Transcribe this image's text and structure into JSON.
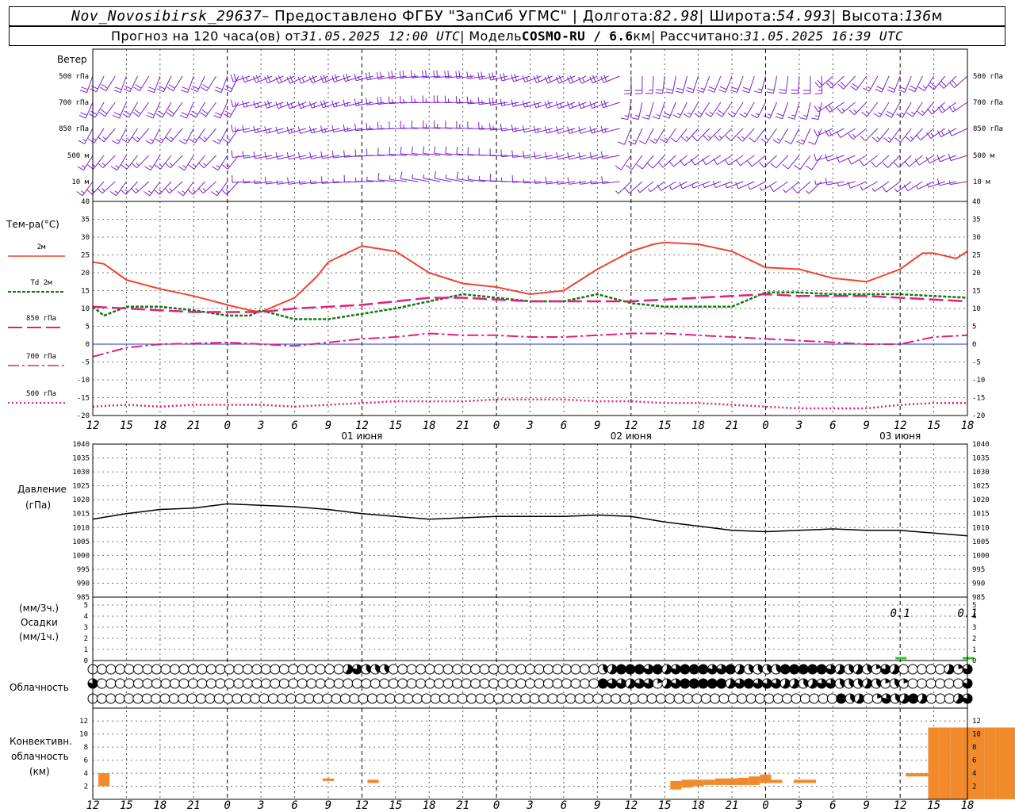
{
  "header": {
    "station": "Nov_Novosibirsk_29637",
    "sep1": " – Предоставлено ФГБУ \"ЗапСиб УГМС\" | Долгота: ",
    "lon": "82.98",
    "sep2": " | Широта: ",
    "lat": "54.993",
    "sep3": " | Высота: ",
    "alt": "136",
    "alt_unit": "м"
  },
  "subheader": {
    "prefix": "Прогноз на 120 часа(ов) от ",
    "issued": "31.05.2025 12:00 UTC",
    "model_prefix": "  | Модель ",
    "model": "COSMO-RU / 6.6",
    "model_unit": "км",
    "calc_prefix": " | Рассчитано: ",
    "calculated": "31.05.2025 16:39 UTC"
  },
  "colors": {
    "t2m": "#ee4433",
    "td2m": "#117711",
    "t850": "#e0207a",
    "t700": "#e0207a",
    "t500": "#e0207a",
    "wind": "#7a22cc",
    "precip": "#22cc22",
    "convective": "#f08a2a",
    "pressure": "#000000",
    "zero_line": "#2233cc"
  },
  "x_axis": {
    "hour_labels": [
      "12",
      "15",
      "18",
      "21",
      "0",
      "3",
      "6",
      "9",
      "12",
      "15",
      "18",
      "21",
      "0",
      "3",
      "6",
      "9",
      "12",
      "15",
      "18",
      "21",
      "0",
      "3",
      "6",
      "9",
      "12",
      "15",
      "18"
    ],
    "date_labels": [
      {
        "label": "01 июня",
        "hour_index": 24
      },
      {
        "label": "02 июня",
        "hour_index": 48
      },
      {
        "label": "03 июня",
        "hour_index": 72
      }
    ]
  },
  "wind_panel": {
    "title": "Ветер",
    "levels": [
      "500 гПа",
      "700 гПа",
      "850 гПа",
      "500 м",
      "10  м"
    ]
  },
  "temp_panel": {
    "title": "Тем-ра(°C)",
    "legend": [
      "2м",
      "Td  2м",
      "850 гПа",
      "700 гПа",
      "500 гПа"
    ],
    "y_ticks": [
      "40",
      "35",
      "30",
      "25",
      "20",
      "15",
      "10",
      "5",
      "0",
      "-5",
      "-10",
      "-15",
      "-20"
    ]
  },
  "pressure_panel": {
    "title": "Давление",
    "unit": "(гПа)",
    "y_ticks": [
      "1040",
      "1035",
      "1030",
      "1025",
      "1020",
      "1015",
      "1010",
      "1005",
      "1000",
      "995",
      "990",
      "985"
    ]
  },
  "precip_panel": {
    "unit_3h": "(мм/3ч.)",
    "title": "Осадки",
    "unit_1h": "(мм/1ч.)",
    "y_ticks": [
      "5",
      "4",
      "3",
      "2",
      "1",
      "0"
    ],
    "annotations": [
      {
        "text": "0.1",
        "hour": 72
      },
      {
        "text": "0.1",
        "hour": 78
      }
    ]
  },
  "cloud_panel": {
    "title": "Облачность"
  },
  "conv_panel": {
    "title_1": "Конвективн.",
    "title_2": "облачность",
    "unit": "(км)",
    "y_ticks": [
      "12",
      "10",
      "8",
      "6",
      "4",
      "2"
    ]
  },
  "chart_data": {
    "type": "line",
    "time_axis": {
      "start": "31.05.2025 12:00 UTC",
      "step_hours": 1,
      "range_hours": [
        0,
        78
      ]
    },
    "series": [
      {
        "name": "2м",
        "x": [
          0,
          1,
          3,
          6,
          9,
          12,
          14,
          15,
          18,
          20,
          21,
          23,
          24,
          27,
          30,
          33,
          36,
          39,
          42,
          45,
          48,
          50,
          51,
          54,
          57,
          60,
          63,
          66,
          69,
          72,
          74,
          75,
          77,
          78
        ],
        "values": [
          23,
          22.5,
          18,
          15.5,
          13.5,
          11,
          9.5,
          9,
          13,
          19,
          23,
          26,
          27.5,
          26,
          20,
          17,
          16,
          14,
          15,
          21,
          26,
          28,
          28.5,
          28,
          26,
          21.5,
          21,
          18.5,
          17.5,
          21,
          25.5,
          25.5,
          24,
          26
        ]
      },
      {
        "name": "Td  2м",
        "x": [
          0,
          1,
          3,
          6,
          9,
          12,
          14,
          15,
          18,
          21,
          24,
          27,
          30,
          33,
          36,
          39,
          42,
          45,
          48,
          51,
          54,
          57,
          60,
          63,
          66,
          69,
          72,
          75,
          78
        ],
        "values": [
          10.5,
          8,
          10.5,
          10.5,
          9.5,
          8,
          8,
          9.5,
          7,
          7,
          8.5,
          10,
          12,
          14,
          13,
          12,
          12,
          14,
          11.5,
          10.5,
          10.5,
          10.5,
          14.5,
          14.5,
          14,
          14,
          14,
          13.5,
          13
        ]
      },
      {
        "name": "850 гПа",
        "x": [
          0,
          3,
          6,
          9,
          12,
          15,
          18,
          21,
          24,
          27,
          30,
          33,
          36,
          39,
          42,
          45,
          48,
          51,
          54,
          57,
          60,
          63,
          66,
          69,
          72,
          75,
          78
        ],
        "values": [
          10.5,
          10,
          9.5,
          9,
          9,
          9,
          10,
          10.5,
          11,
          12,
          13,
          13,
          12.5,
          12,
          12,
          12,
          12,
          12.5,
          13,
          13.5,
          14,
          13.5,
          13.5,
          13.5,
          13,
          12.5,
          12
        ]
      },
      {
        "name": "700 гПа",
        "x": [
          0,
          3,
          6,
          9,
          12,
          15,
          18,
          21,
          24,
          27,
          30,
          33,
          36,
          39,
          42,
          45,
          48,
          51,
          54,
          57,
          60,
          63,
          66,
          69,
          72,
          75,
          78
        ],
        "values": [
          -3.5,
          -1,
          0,
          0.2,
          0.5,
          0,
          -0.5,
          0.5,
          1.5,
          2,
          3,
          2.5,
          2.5,
          2,
          2,
          2.5,
          3,
          3,
          2.5,
          2,
          1.5,
          1,
          0.5,
          0,
          0,
          2,
          2.5
        ]
      },
      {
        "name": "500 гПа",
        "x": [
          0,
          3,
          6,
          9,
          12,
          15,
          18,
          21,
          24,
          27,
          30,
          33,
          36,
          39,
          42,
          45,
          48,
          51,
          54,
          57,
          60,
          63,
          66,
          69,
          72,
          75,
          78
        ],
        "values": [
          -17.5,
          -17,
          -17.5,
          -17,
          -17,
          -17,
          -17.5,
          -17,
          -16.5,
          -16,
          -16,
          -16,
          -15.5,
          -15.5,
          -15.5,
          -16,
          -16,
          -16.5,
          -16.5,
          -17,
          -17.5,
          -18,
          -18,
          -18,
          -17,
          -16.5,
          -16.5
        ]
      },
      {
        "name": "Давление",
        "x": [
          0,
          3,
          6,
          9,
          12,
          15,
          18,
          21,
          24,
          27,
          30,
          33,
          36,
          39,
          42,
          45,
          48,
          51,
          54,
          57,
          60,
          63,
          66,
          69,
          72,
          75,
          78
        ],
        "values": [
          1013,
          1015,
          1016.5,
          1017,
          1018.5,
          1018,
          1017.5,
          1016.5,
          1015,
          1014,
          1013,
          1013.5,
          1014,
          1014,
          1014,
          1014.5,
          1014,
          1012,
          1010.5,
          1009,
          1008.5,
          1009,
          1009.5,
          1009,
          1009,
          1008,
          1007
        ]
      }
    ],
    "ylim_temp": [
      -20,
      40
    ],
    "ylim_pressure": [
      985,
      1040
    ],
    "precip": [
      {
        "hour": 72,
        "mm": 0.1
      },
      {
        "hour": 78,
        "mm": 0.1
      }
    ],
    "convective_cloud_km": [
      {
        "hour": 1,
        "top": 4,
        "base": 2
      },
      {
        "hour": 21,
        "top": 3.2,
        "base": 2.8
      },
      {
        "hour": 25,
        "top": 3,
        "base": 2.5
      },
      {
        "hour": 52,
        "top": 2.8,
        "base": 1.5
      },
      {
        "hour": 53,
        "top": 3,
        "base": 1.8
      },
      {
        "hour": 54,
        "top": 3,
        "base": 2
      },
      {
        "hour": 55,
        "top": 3,
        "base": 2.2
      },
      {
        "hour": 56,
        "top": 3.2,
        "base": 2.2
      },
      {
        "hour": 57,
        "top": 3.2,
        "base": 2.2
      },
      {
        "hour": 58,
        "top": 3.3,
        "base": 2.2
      },
      {
        "hour": 59,
        "top": 3.5,
        "base": 2.2
      },
      {
        "hour": 60,
        "top": 3.8,
        "base": 2.5
      },
      {
        "hour": 61,
        "top": 3,
        "base": 2.5
      },
      {
        "hour": 63,
        "top": 3,
        "base": 2.5
      },
      {
        "hour": 64,
        "top": 3,
        "base": 2.5
      },
      {
        "hour": 73,
        "top": 4,
        "base": 3.5
      },
      {
        "hour": 74,
        "top": 4,
        "base": 3.5
      },
      {
        "hour": 75,
        "top": 11,
        "base": 0
      },
      {
        "hour": 76,
        "top": 11,
        "base": 0
      },
      {
        "hour": 77,
        "top": 11,
        "base": 0
      },
      {
        "hour": 78,
        "top": 11,
        "base": 0
      },
      {
        "hour": 79,
        "top": 11,
        "base": 0
      },
      {
        "hour": 80,
        "top": 11,
        "base": 0
      },
      {
        "hour": 81,
        "top": 11,
        "base": 0
      },
      {
        "hour": 82,
        "top": 11,
        "base": 0
      },
      {
        "hour": 83,
        "top": 11,
        "base": 0
      },
      {
        "hour": 84,
        "top": 11.8,
        "base": 0
      },
      {
        "hour": 85,
        "top": 2.5,
        "base": 2
      },
      {
        "hour": 86,
        "top": 2.5,
        "base": 2
      }
    ],
    "cloud_cover_tenths": {
      "note_rows": [
        "high",
        "middle",
        "low"
      ],
      "high": [
        0,
        0,
        0,
        0,
        0,
        0,
        0,
        0,
        0,
        0,
        0,
        0,
        0,
        0,
        0,
        0,
        0,
        0,
        0,
        0,
        0,
        0,
        0,
        0,
        0,
        0,
        0,
        0,
        6,
        8,
        4,
        4,
        4,
        0,
        0,
        0,
        0,
        0,
        0,
        0,
        0,
        0,
        0,
        0,
        0,
        0,
        0,
        0,
        0,
        0,
        0,
        0,
        0,
        0,
        0,
        0,
        4,
        6,
        10,
        10,
        10,
        8,
        10,
        6,
        8,
        10,
        10,
        10,
        8,
        8,
        10,
        6,
        4,
        4,
        4,
        4,
        10,
        10,
        10,
        10,
        10,
        8,
        6,
        4,
        6,
        4,
        2,
        8,
        6,
        0,
        0,
        0,
        0,
        0,
        6,
        2,
        8
      ],
      "middle": [
        8,
        0,
        0,
        0,
        0,
        0,
        0,
        0,
        0,
        0,
        0,
        0,
        0,
        0,
        0,
        0,
        0,
        0,
        0,
        0,
        0,
        0,
        0,
        0,
        0,
        0,
        0,
        0,
        0,
        0,
        0,
        0,
        0,
        0,
        0,
        0,
        0,
        0,
        0,
        0,
        0,
        0,
        0,
        0,
        0,
        0,
        0,
        0,
        0,
        0,
        0,
        0,
        0,
        0,
        0,
        0,
        10,
        8,
        8,
        6,
        8,
        8,
        2,
        6,
        8,
        10,
        10,
        10,
        10,
        10,
        6,
        8,
        10,
        8,
        8,
        8,
        6,
        6,
        4,
        6,
        8,
        8,
        4,
        4,
        4,
        6,
        4,
        2,
        4,
        2,
        0,
        0,
        0,
        0,
        0,
        0,
        8
      ],
      "low": [
        0,
        0,
        0,
        0,
        0,
        0,
        0,
        0,
        0,
        0,
        0,
        0,
        0,
        0,
        0,
        0,
        0,
        0,
        0,
        0,
        0,
        0,
        0,
        0,
        0,
        0,
        0,
        0,
        0,
        0,
        0,
        0,
        0,
        0,
        0,
        0,
        0,
        0,
        0,
        0,
        0,
        0,
        0,
        0,
        0,
        0,
        0,
        0,
        0,
        0,
        0,
        0,
        0,
        0,
        0,
        0,
        0,
        0,
        0,
        0,
        0,
        0,
        0,
        0,
        0,
        0,
        0,
        0,
        0,
        0,
        0,
        0,
        0,
        0,
        0,
        0,
        0,
        0,
        0,
        0,
        0,
        0,
        0,
        10,
        4,
        6,
        0,
        2,
        8,
        4,
        6,
        10,
        6,
        0,
        0,
        0,
        6,
        8
      ]
    }
  }
}
